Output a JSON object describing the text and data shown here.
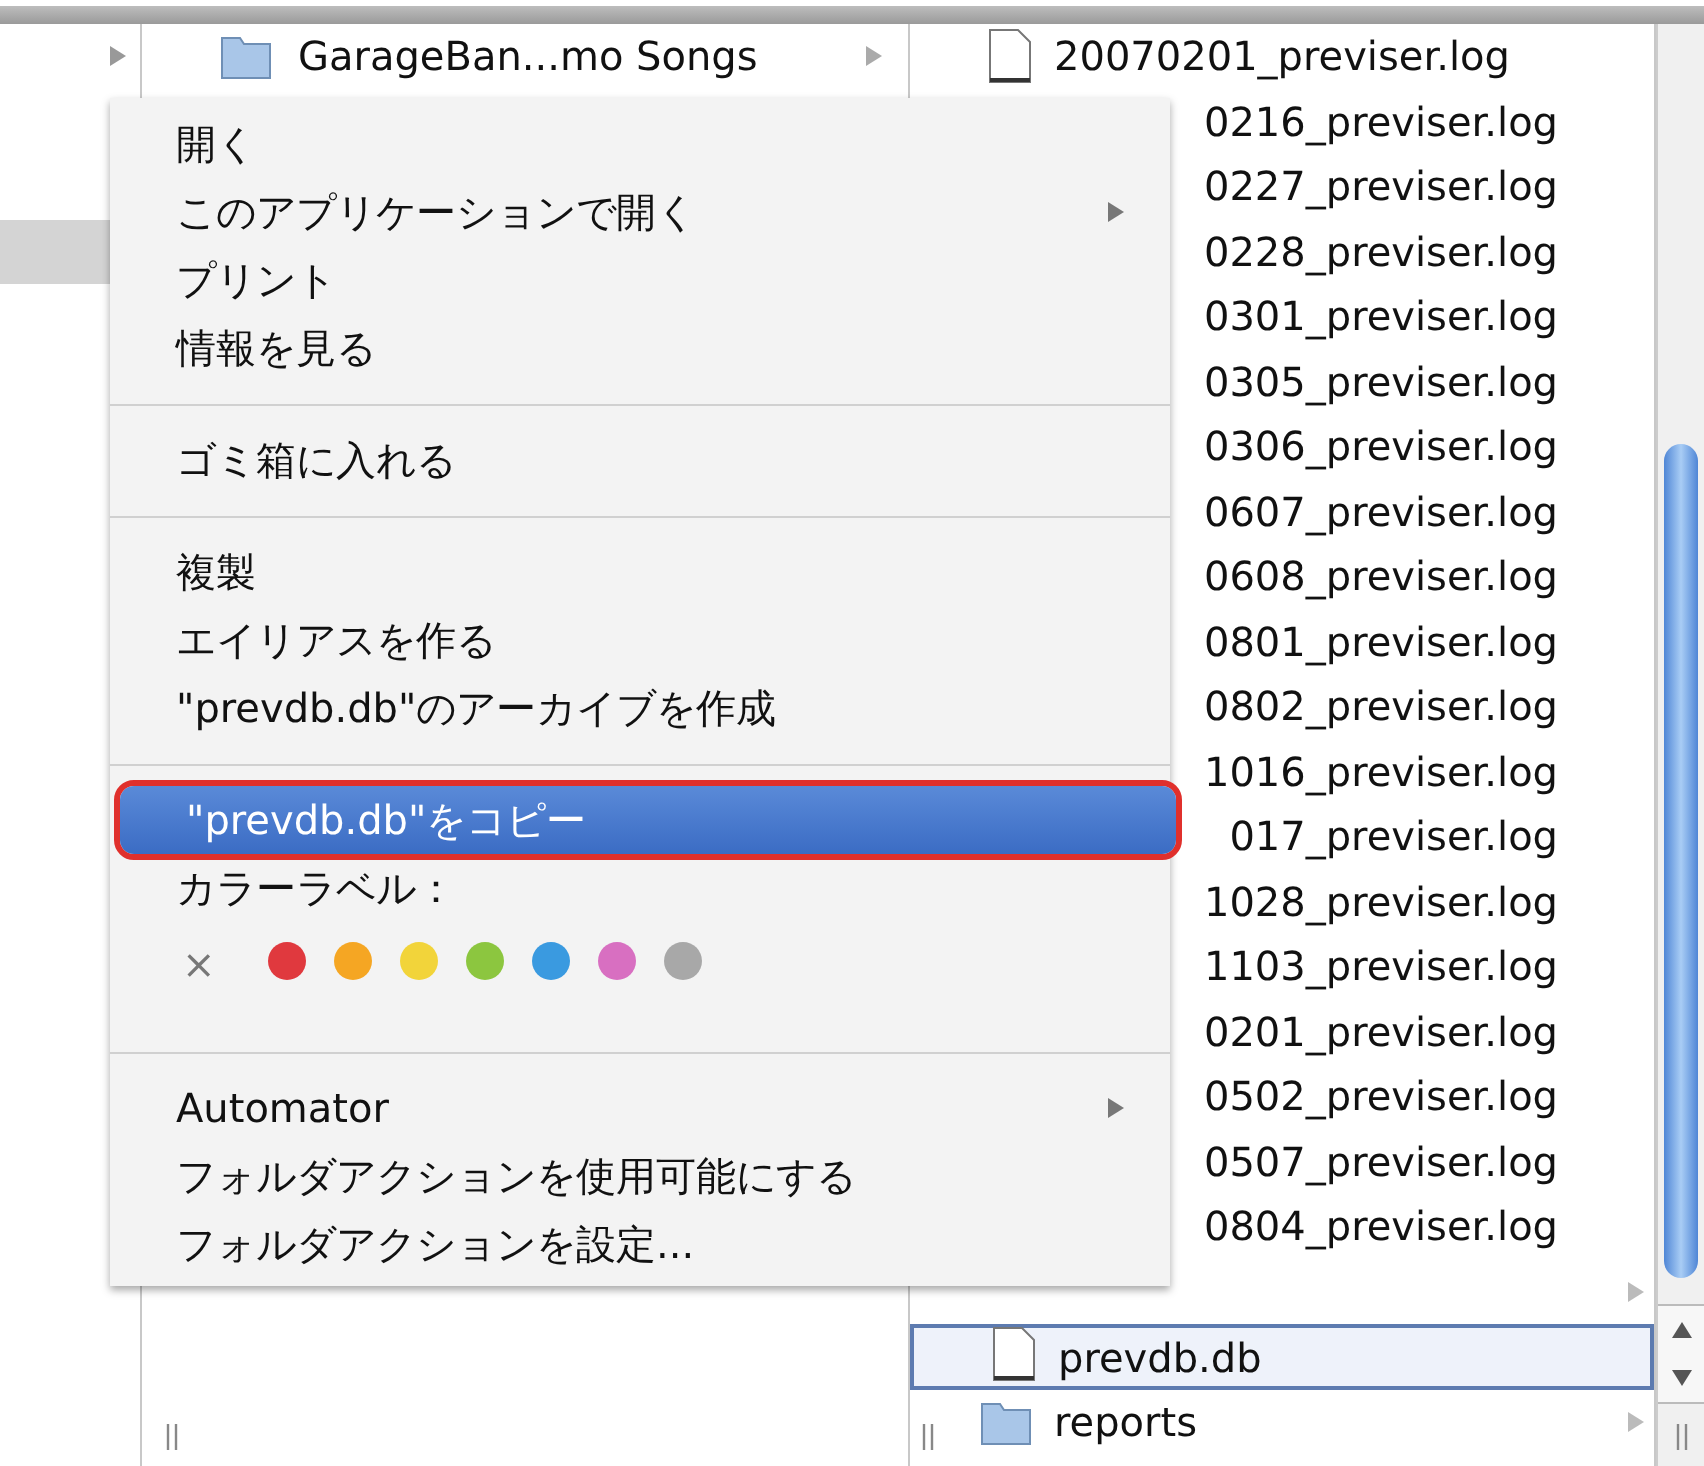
{
  "left_column": {
    "rows": [
      {
        "expandable": true,
        "selected": false
      },
      {
        "selected": false
      },
      {
        "selected": false
      },
      {
        "selected": true
      }
    ]
  },
  "middle_column": {
    "rows": [
      {
        "kind": "folder",
        "name": "GarageBan...mo Songs",
        "expandable": true,
        "selected": false
      }
    ]
  },
  "right_column": {
    "rows": [
      {
        "kind": "file",
        "name": "20070201_previser.log",
        "covered": false,
        "expandable": false,
        "selected": false
      },
      {
        "name": "0216_previser.log",
        "covered": true,
        "expandable": false,
        "selected": false
      },
      {
        "name": "0227_previser.log",
        "covered": true,
        "expandable": false,
        "selected": false
      },
      {
        "name": "0228_previser.log",
        "covered": true,
        "expandable": false,
        "selected": false
      },
      {
        "name": "0301_previser.log",
        "covered": true,
        "expandable": false,
        "selected": false
      },
      {
        "name": "0305_previser.log",
        "covered": true,
        "expandable": false,
        "selected": false
      },
      {
        "name": "0306_previser.log",
        "covered": true,
        "expandable": false,
        "selected": false
      },
      {
        "name": "0607_previser.log",
        "covered": true,
        "expandable": false,
        "selected": false
      },
      {
        "name": "0608_previser.log",
        "covered": true,
        "expandable": false,
        "selected": false
      },
      {
        "name": "0801_previser.log",
        "covered": true,
        "expandable": false,
        "selected": false
      },
      {
        "name": "0802_previser.log",
        "covered": true,
        "expandable": false,
        "selected": false
      },
      {
        "name": "1016_previser.log",
        "covered": true,
        "expandable": false,
        "selected": false
      },
      {
        "name": "017_previser.log",
        "covered": true,
        "expandable": false,
        "selected": false
      },
      {
        "name": "1028_previser.log",
        "covered": true,
        "expandable": false,
        "selected": false
      },
      {
        "name": "1103_previser.log",
        "covered": true,
        "expandable": false,
        "selected": false
      },
      {
        "name": "0201_previser.log",
        "covered": true,
        "expandable": false,
        "selected": false
      },
      {
        "name": "0502_previser.log",
        "covered": true,
        "expandable": false,
        "selected": false
      },
      {
        "name": "0507_previser.log",
        "covered": true,
        "expandable": false,
        "selected": false
      },
      {
        "name": "0804_previser.log",
        "covered": true,
        "expandable": false,
        "selected": false
      },
      {
        "covered": true,
        "expandable": true,
        "selected": false
      },
      {
        "kind": "file",
        "name": "prevdb.db",
        "covered": false,
        "expandable": false,
        "selected": true
      },
      {
        "kind": "folder",
        "name": "reports",
        "covered": false,
        "expandable": true,
        "selected": false
      }
    ]
  },
  "context_menu": {
    "items": [
      {
        "kind": "item",
        "label": "開く",
        "submenu": false,
        "selected": false
      },
      {
        "kind": "item",
        "label": "このアプリケーションで開く",
        "submenu": true,
        "selected": false
      },
      {
        "kind": "item",
        "label": "プリント",
        "submenu": false,
        "selected": false
      },
      {
        "kind": "item",
        "label": "情報を見る",
        "selected": false
      },
      {
        "kind": "separator"
      },
      {
        "kind": "item",
        "label": "ゴミ箱に入れる",
        "submenu": false,
        "selected": false
      },
      {
        "kind": "separator"
      },
      {
        "kind": "item",
        "label": "複製",
        "submenu": false,
        "selected": false
      },
      {
        "kind": "item",
        "label": "エイリアスを作る",
        "submenu": false,
        "selected": false
      },
      {
        "kind": "item",
        "label": "\"prevdb.db\"のアーカイブを作成",
        "submenu": false,
        "selected": false
      },
      {
        "kind": "separator"
      },
      {
        "kind": "item",
        "label": "\"prevdb.db\"をコピー",
        "submenu": false,
        "selected": true,
        "annotated": true
      },
      {
        "kind": "heading",
        "label": "カラーラベル："
      },
      {
        "kind": "colors",
        "none_label": "×",
        "colors": [
          {
            "color": "#e0393e"
          },
          {
            "color": "#f5a623"
          },
          {
            "color": "#f2d43a"
          },
          {
            "color": "#8cc63f"
          },
          {
            "color": "#3a9ae0"
          },
          {
            "color": "#d86fc1"
          },
          {
            "color": "#a8a8a8"
          }
        ]
      },
      {
        "kind": "separator"
      },
      {
        "kind": "item",
        "label": "Automator",
        "submenu": true,
        "selected": false
      },
      {
        "kind": "item",
        "label": "フォルダアクションを使用可能にする",
        "submenu": false,
        "selected": false
      },
      {
        "kind": "item",
        "label": "フォルダアクションを設定...",
        "submenu": false,
        "selected": false
      }
    ]
  }
}
